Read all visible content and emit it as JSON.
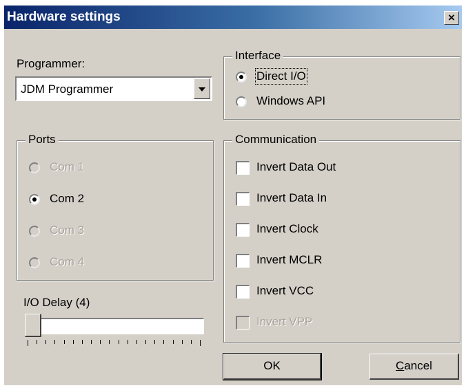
{
  "window": {
    "title": "Hardware settings",
    "close_label": "×"
  },
  "programmer": {
    "label": "Programmer:",
    "selected": "JDM Programmer"
  },
  "interface": {
    "legend": "Interface",
    "options": [
      {
        "label": "Direct I/O",
        "selected": true
      },
      {
        "label": "Windows API",
        "selected": false
      }
    ]
  },
  "ports": {
    "legend": "Ports",
    "options": [
      {
        "label": "Com 1",
        "selected": false,
        "enabled": false
      },
      {
        "label": "Com 2",
        "selected": true,
        "enabled": true
      },
      {
        "label": "Com 3",
        "selected": false,
        "enabled": false
      },
      {
        "label": "Com 4",
        "selected": false,
        "enabled": false
      }
    ]
  },
  "communication": {
    "legend": "Communication",
    "options": [
      {
        "label": "Invert Data Out",
        "checked": false,
        "enabled": true
      },
      {
        "label": "Invert Data In",
        "checked": false,
        "enabled": true
      },
      {
        "label": "Invert Clock",
        "checked": false,
        "enabled": true
      },
      {
        "label": "Invert MCLR",
        "checked": false,
        "enabled": true
      },
      {
        "label": "Invert VCC",
        "checked": false,
        "enabled": true
      },
      {
        "label": "Invert VPP",
        "checked": false,
        "enabled": false
      }
    ]
  },
  "io_delay": {
    "label": "I/O Delay (4)",
    "value": 4,
    "min": 4,
    "max": 60
  },
  "buttons": {
    "ok": "OK",
    "cancel_prefix": "C",
    "cancel_rest": "ancel"
  },
  "colors": {
    "face": "#d4d0c8",
    "title_start": "#0a246a",
    "title_end": "#a6caf0",
    "disabled_text": "#a8a49c"
  }
}
